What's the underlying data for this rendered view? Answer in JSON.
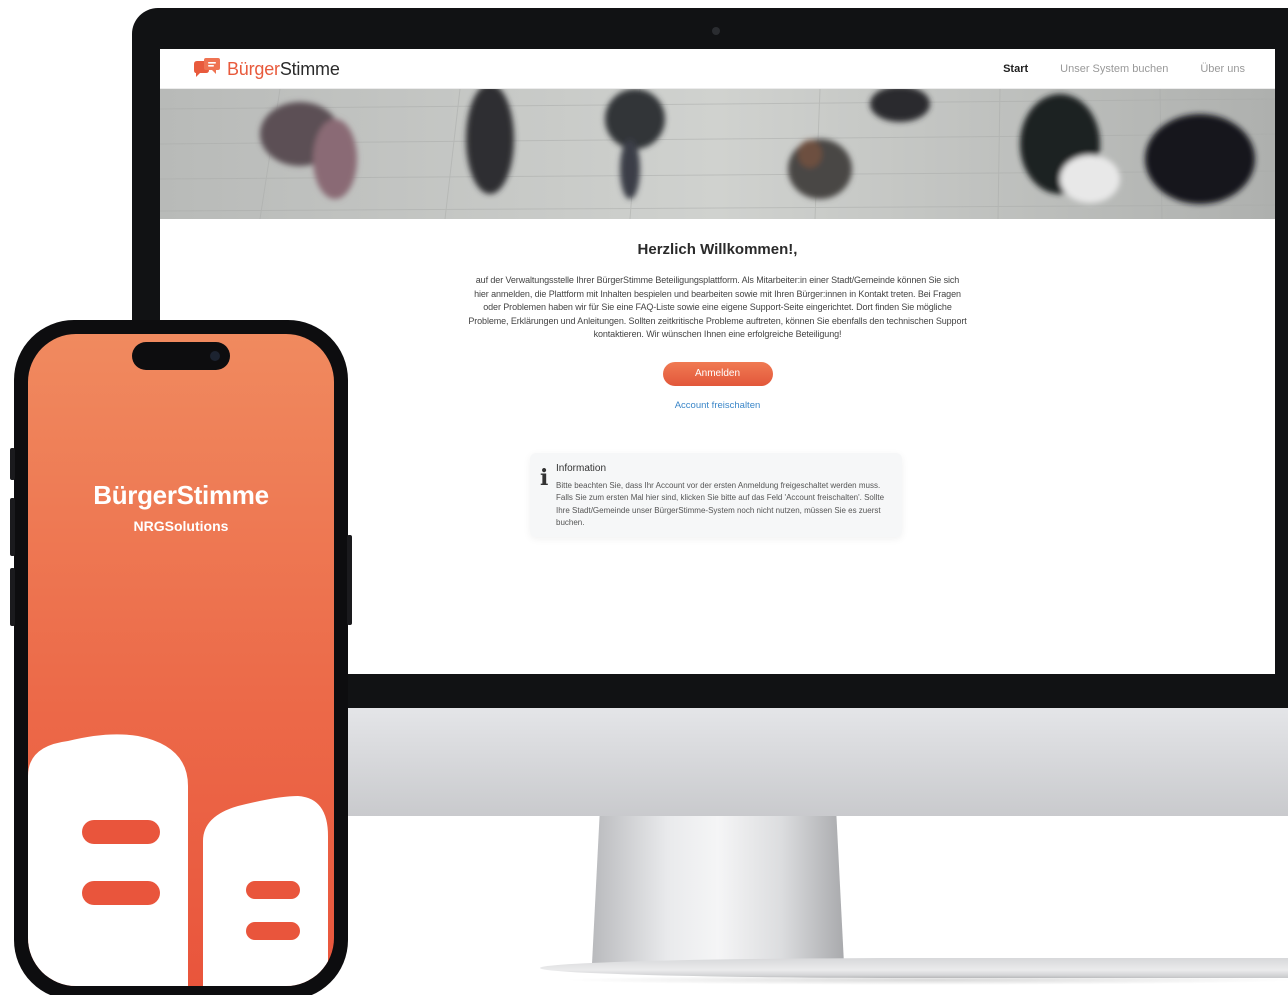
{
  "brand": {
    "name_part1": "Bürger",
    "name_part2": "Stimme",
    "accent_color": "#e85a3c"
  },
  "nav": {
    "items": [
      {
        "label": "Start",
        "active": true
      },
      {
        "label": "Unser System buchen",
        "active": false
      },
      {
        "label": "Über uns",
        "active": false
      }
    ]
  },
  "hero": {
    "icon": "crowd-photo"
  },
  "main": {
    "heading": "Herzlich Willkommen!,",
    "intro": "auf der Verwaltungsstelle Ihrer BürgerStimme Beteiligungsplattform. Als Mitarbeiter:in einer Stadt/Gemeinde können Sie sich hier anmelden, die Plattform mit Inhalten bespielen und bearbeiten sowie mit Ihren Bürger:innen in Kontakt treten. Bei Fragen oder Problemen haben wir für Sie eine FAQ-Liste sowie eine eigene Support-Seite eingerichtet. Dort finden Sie mögliche Probleme, Erklärungen und Anleitungen. Sollten zeitkritische Probleme auftreten, können Sie ebenfalls den technischen Support kontaktieren. Wir wünschen Ihnen eine erfolgreiche Beteiligung!",
    "login_button": "Anmelden",
    "activate_link": "Account freischalten"
  },
  "info": {
    "icon": "info-icon",
    "title": "Information",
    "text": "Bitte beachten Sie, dass Ihr Account vor der ersten Anmeldung freigeschaltet werden muss. Falls Sie zum ersten Mal hier sind, klicken Sie bitte auf das Feld 'Account freischalten'. Sollte Ihre Stadt/Gemeinde unser BürgerStimme-System noch nicht nutzen, müssen Sie es zuerst buchen."
  },
  "phone": {
    "title": "BürgerStimme",
    "subtitle": "NRGSolutions",
    "background_color": "#ec6a49"
  }
}
